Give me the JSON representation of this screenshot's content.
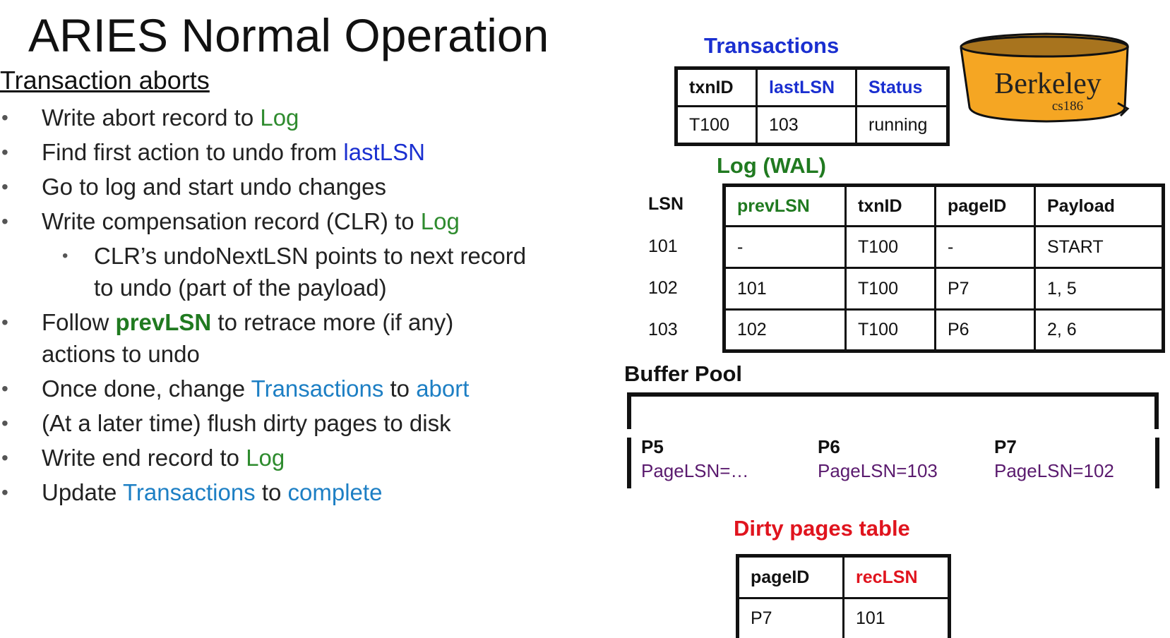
{
  "title": "ARIES Normal Operation",
  "subtitle": "Transaction aborts",
  "bullets": {
    "b1_pre": "Write abort record to ",
    "b1_hl": "Log",
    "b2_pre": "Find first action to undo from ",
    "b2_hl": "lastLSN",
    "b3": "Go to log and start undo changes",
    "b4_pre": "Write compensation record (CLR) to ",
    "b4_hl": "Log",
    "b5_line1": "CLR’s undoNextLSN points to next record",
    "b5_line2": "to undo (part of the payload)",
    "b6_pre": "Follow ",
    "b6_hl": "prevLSN",
    "b6_post": " to retrace more (if any)",
    "b6_line2": "actions to undo",
    "b7_pre": "Once done, change ",
    "b7_hl1": "Transactions",
    "b7_mid": " to ",
    "b7_hl2": "abort",
    "b8": "(At a later time) flush dirty pages to disk",
    "b9_pre": "Write end record to ",
    "b9_hl": "Log",
    "b10_pre": "Update ",
    "b10_hl1": "Transactions",
    "b10_mid": " to ",
    "b10_hl2": "complete"
  },
  "transactions": {
    "title": "Transactions",
    "headers": [
      "txnID",
      "lastLSN",
      "Status"
    ],
    "rows": [
      [
        "T100",
        "103",
        "running"
      ]
    ]
  },
  "badge": {
    "text": "Berkeley",
    "course": "cs186"
  },
  "log": {
    "title": "Log (WAL)",
    "lsn_header": "LSN",
    "headers": [
      "prevLSN",
      "txnID",
      "pageID",
      "Payload"
    ],
    "lsns": [
      "101",
      "102",
      "103"
    ],
    "rows": [
      [
        "-",
        "T100",
        "-",
        "START"
      ],
      [
        "101",
        "T100",
        "P7",
        "1, 5"
      ],
      [
        "102",
        "T100",
        "P6",
        "2, 6"
      ]
    ]
  },
  "buffer_pool": {
    "title": "Buffer Pool",
    "pages": [
      {
        "id": "P5",
        "lsn": "PageLSN=…"
      },
      {
        "id": "P6",
        "lsn": "PageLSN=103"
      },
      {
        "id": "P7",
        "lsn": "PageLSN=102"
      }
    ]
  },
  "dirty_pages": {
    "title": "Dirty pages table",
    "headers": [
      "pageID",
      "recLSN"
    ],
    "rows": [
      [
        "P7",
        "101"
      ]
    ]
  },
  "colors": {
    "log_green": "#2e8b2e",
    "lastlsn_blue": "#1a2fd0",
    "transactions_teal": "#1d7fc4",
    "dirty_red": "#e0141e",
    "pagelsn_purple": "#5a1a6e",
    "badge_orange": "#f5a623"
  }
}
